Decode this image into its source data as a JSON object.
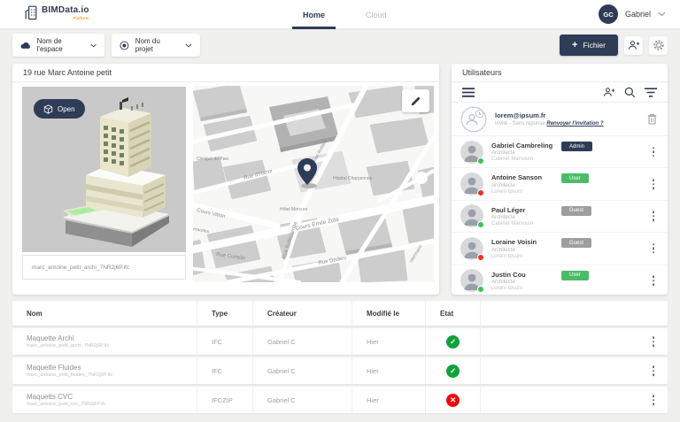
{
  "colors": {
    "primary": "#2e3c56",
    "accent_orange": "#f2a93b",
    "badge_admin": "#2e3c56",
    "badge_user": "#4cbb67",
    "badge_guest": "#9e9e9e",
    "success": "#12a13a",
    "danger": "#ea0b0b",
    "presence_green": "#3fc353",
    "presence_red": "#ee3124"
  },
  "header": {
    "brand": {
      "name": "BIMData.io",
      "tagline": "Platform"
    },
    "tabs": [
      {
        "label": "Home",
        "active": true
      },
      {
        "label": "Cloud",
        "active": false
      }
    ],
    "user": {
      "initials": "GC",
      "name": "Gabriel"
    }
  },
  "filterbar": {
    "space_selector": {
      "label": "Nom de l'espace"
    },
    "project_selector": {
      "label": "Nom du projet"
    },
    "add_file_button": "Fichier"
  },
  "project_card": {
    "title": "19 rue Marc Antoine petit",
    "viewer": {
      "open_button": "Open",
      "file_name": "marc_antoine_petit_archi_7NR2j6P.ifc"
    },
    "map": {
      "labels": [
        "Clinique du Parc",
        "Cours Vitton",
        "Rue d'Hanoi",
        "Rue Henri Rolland",
        "Hôpital Charpennes",
        "Hôtel Mercure",
        "Cours Émile Zola",
        "Rue Curtelin",
        "Rue Bellecombe",
        "Rue Dedieu",
        "eraudes",
        "nkermann"
      ]
    }
  },
  "users_card": {
    "title": "Utilisateurs",
    "invite": {
      "email": "lorem@ipsum.fr",
      "status": "Invité - Sans réponse",
      "action": "Renvoyer l'invitation ?"
    },
    "users": [
      {
        "name": "Gabriel Cambreling",
        "role": "Architecte",
        "company": "Cabinet Marsouin",
        "badge": "Admin",
        "presence": "green"
      },
      {
        "name": "Antoine Sanson",
        "role": "Architecte",
        "company": "Lorem Ipsum",
        "badge": "User",
        "presence": "red"
      },
      {
        "name": "Paul Léger",
        "role": "Architecte",
        "company": "Cabinet Marsouin",
        "badge": "Guest",
        "presence": "green"
      },
      {
        "name": "Loraine Voisin",
        "role": "Architecte",
        "company": "Lorem Ipsum",
        "badge": "Guest",
        "presence": "red"
      },
      {
        "name": "Justin Cou",
        "role": "Architecte",
        "company": "Lorem Ipsum",
        "badge": "User",
        "presence": "green"
      }
    ]
  },
  "files_table": {
    "columns": [
      "Nom",
      "Type",
      "Créateur",
      "Modifié le",
      "Etat"
    ],
    "rows": [
      {
        "name": "Maquette Archi",
        "file": "marc_antoine_petit_archi_7NR2j6P.ifc",
        "type": "IFC",
        "creator": "Gabriel C",
        "modified": "Hier",
        "state": "ok"
      },
      {
        "name": "Maquette Fluides",
        "file": "marc_antoine_petit_fluides_7NR2j6P.ifc",
        "type": "IFC",
        "creator": "Gabriel C",
        "modified": "Hier",
        "state": "ok"
      },
      {
        "name": "Maquetts CVC",
        "file": "marc_antoine_petit_cvc_7NR2j6P.ifc",
        "type": "IFCZIP",
        "creator": "Gabriel C",
        "modified": "Hier",
        "state": "error"
      }
    ]
  }
}
